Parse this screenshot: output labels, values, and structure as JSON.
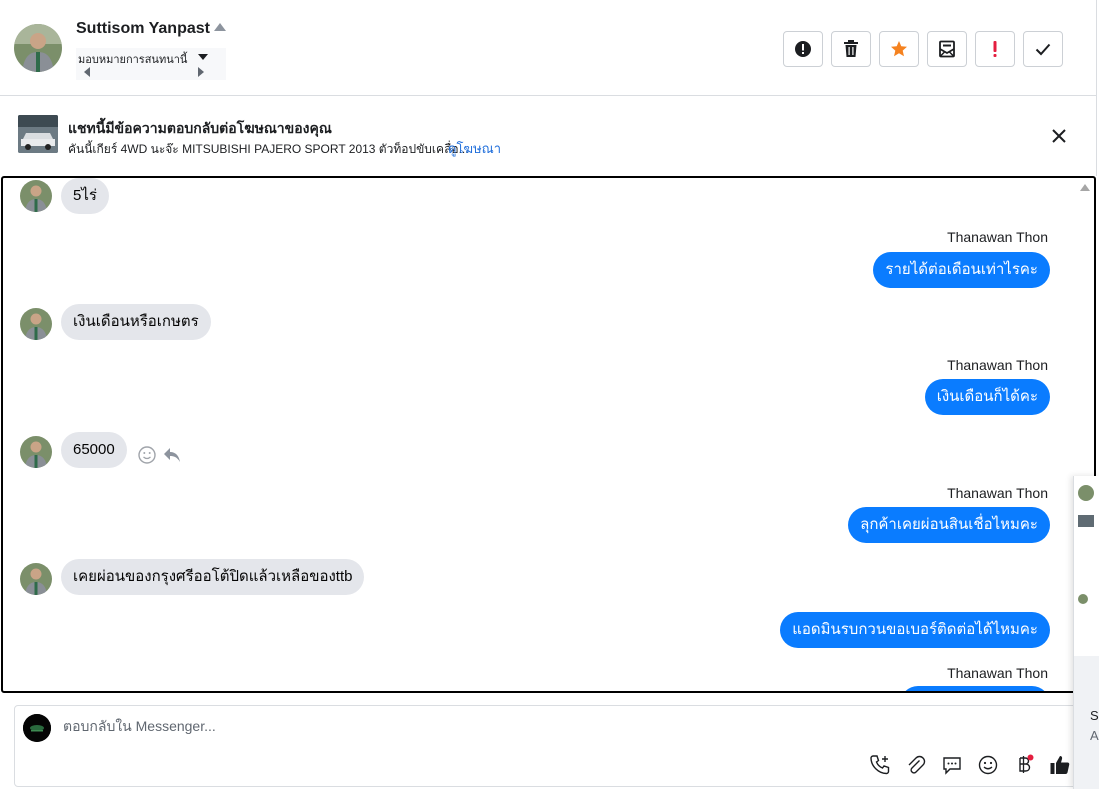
{
  "header": {
    "contact_name": "Suttisom Yanpast",
    "assign_label": "มอบหมายการสนทนานี้",
    "actions": [
      {
        "name": "report-button",
        "icon": "alert-circle-icon"
      },
      {
        "name": "delete-button",
        "icon": "trash-icon"
      },
      {
        "name": "star-button",
        "icon": "star-icon"
      },
      {
        "name": "mark-unread-button",
        "icon": "envelope-icon"
      },
      {
        "name": "flag-button",
        "icon": "exclamation-icon"
      },
      {
        "name": "done-button",
        "icon": "check-icon"
      }
    ]
  },
  "ad_banner": {
    "title": "แชทนี้มีข้อความตอบกลับต่อโฆษณาของคุณ",
    "description": "คันนี้เกียร์ 4WD นะจ๊ะ MITSUBISHI PAJERO SPORT 2013 ตัวท็อปขับเคลื่อ...",
    "link": "ดูโฆษณา"
  },
  "messages": [
    {
      "direction": "in",
      "text": "5ไร่"
    },
    {
      "direction": "out",
      "sender": "Thanawan Thon",
      "text": "รายได้ต่อเดือนเท่าไรคะ"
    },
    {
      "direction": "in",
      "text": "เงินเดือนหรือเกษตร"
    },
    {
      "direction": "out",
      "sender": "Thanawan Thon",
      "text": "เงินเดือนก็ได้คะ"
    },
    {
      "direction": "in",
      "text": "65000"
    },
    {
      "direction": "out",
      "sender": "Thanawan Thon",
      "text": "ลุกค้าเคยผ่อนสินเชื่อไหมคะ"
    },
    {
      "direction": "in",
      "text": "เคยผ่อนของกรุงศรีออโต้ปิดแล้วเหลือของttb"
    },
    {
      "direction": "out",
      "text": "แอดมินรบกวนขอเบอร์ติดต่อได้ไหมคะ"
    },
    {
      "direction": "out",
      "sender": "Thanawan Thon",
      "text": ""
    }
  ],
  "composer": {
    "placeholder": "ตอบกลับใน Messenger...",
    "tools": [
      "phone-plus-icon",
      "paperclip-icon",
      "chat-bubble-icon",
      "smiley-icon",
      "baht-icon",
      "thumbs-up-icon"
    ]
  },
  "side_peek": {
    "text_1": "Se",
    "text_2": "A"
  },
  "colors": {
    "accent": "#0a7cff",
    "star": "#f5821f",
    "flag": "#e41e3f",
    "incoming_bubble": "#e4e6eb"
  }
}
